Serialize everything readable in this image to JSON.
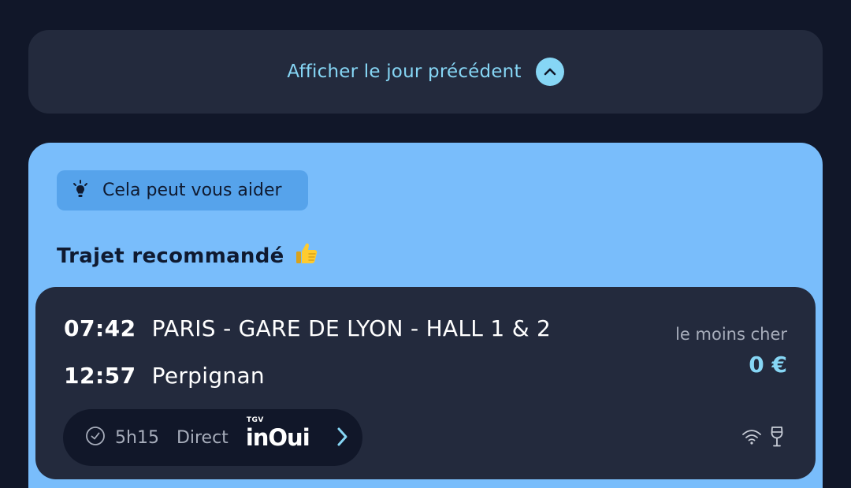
{
  "prev_day": {
    "label": "Afficher le jour précédent",
    "icon": "chevron-up-icon"
  },
  "recommendation": {
    "chip_label": "Cela peut vous aider",
    "chip_icon": "lightbulb-icon",
    "title": "Trajet recommandé",
    "title_emoji": "👍",
    "trip": {
      "departure_time": "07:42",
      "departure_station": "PARIS - GARE DE LYON - HALL 1 & 2",
      "arrival_time": "12:57",
      "arrival_station": "Perpignan",
      "price_caption": "le moins cher",
      "price": "0 €",
      "duration": "5h15",
      "type": "Direct",
      "brand_small": "TGV",
      "brand": "inOui",
      "amenities": [
        "wifi-icon",
        "wine-glass-icon"
      ]
    }
  },
  "colors": {
    "background": "#111729",
    "card": "#232a3d",
    "accent": "#86d6f5",
    "recommendation_bg": "#79bdfb",
    "chip_bg": "#56a3eb"
  }
}
